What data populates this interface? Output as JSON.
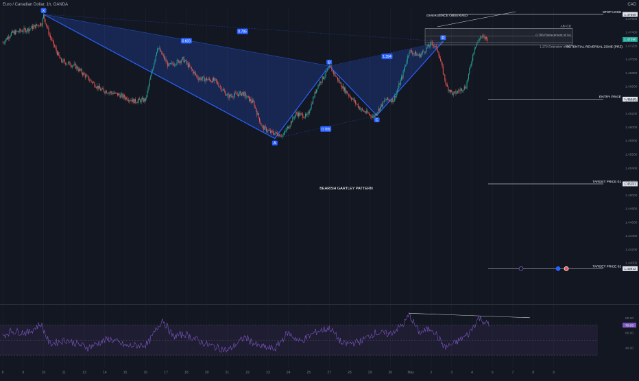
{
  "header": {
    "symbol_title": "Euro / Canadian Dollar, 1h, OANDA",
    "currency": "CAD"
  },
  "colors": {
    "background": "#131722",
    "up_candle": "#26a69a",
    "down_candle": "#ef5350",
    "pattern_line": "#2962ff",
    "pattern_fill": "#2962ff",
    "rsi_line": "#7e57c2",
    "rsi_band": "#7e57c2",
    "text": "#d1d4dc",
    "axis_text": "#787b86",
    "price_tag_bg": "#e0e3eb"
  },
  "chart_data": {
    "type": "candlestick",
    "title": "Euro / Canadian Dollar, 1h, OANDA",
    "y_price_range": [
      1.4342,
      1.4777
    ],
    "y_ticks": [
      "1.47600",
      "1.47400",
      "1.47200",
      "1.47000",
      "1.46800",
      "1.46600",
      "1.46400",
      "1.46200",
      "1.46000",
      "1.45800",
      "1.45600",
      "1.45400",
      "1.45200",
      "1.45000",
      "1.44800",
      "1.44600",
      "1.44400",
      "1.44200",
      "1.44000"
    ],
    "y_tick_values": [
      1.476,
      1.474,
      1.472,
      1.47,
      1.468,
      1.466,
      1.464,
      1.462,
      1.46,
      1.458,
      1.456,
      1.454,
      1.452,
      1.45,
      1.448,
      1.446,
      1.444,
      1.442,
      1.44
    ],
    "x_ticks": [
      "8",
      "9",
      "10",
      "11",
      "13",
      "14",
      "15",
      "16",
      "17",
      "18",
      "20",
      "21",
      "22",
      "23",
      "24",
      "25",
      "27",
      "28",
      "29",
      "30",
      "May",
      "2",
      "3",
      "4",
      "6",
      "7",
      "8",
      "9"
    ],
    "x_tick_bar": [
      0,
      24,
      48,
      72,
      96,
      120,
      144,
      168,
      192,
      216,
      240,
      264,
      288,
      312,
      336,
      360,
      384,
      408,
      432,
      456,
      480,
      504,
      528,
      552,
      576,
      600,
      624,
      648
    ],
    "series_pivots": [
      [
        0,
        1.4724
      ],
      [
        10,
        1.4738
      ],
      [
        30,
        1.4744
      ],
      [
        46,
        1.4753
      ],
      [
        48,
        1.4764
      ],
      [
        55,
        1.4735
      ],
      [
        68,
        1.4698
      ],
      [
        85,
        1.469
      ],
      [
        100,
        1.4672
      ],
      [
        115,
        1.4655
      ],
      [
        135,
        1.4648
      ],
      [
        155,
        1.4638
      ],
      [
        168,
        1.464
      ],
      [
        182,
        1.4718
      ],
      [
        195,
        1.469
      ],
      [
        212,
        1.47
      ],
      [
        230,
        1.4672
      ],
      [
        250,
        1.4668
      ],
      [
        265,
        1.4645
      ],
      [
        282,
        1.465
      ],
      [
        295,
        1.4635
      ],
      [
        305,
        1.46
      ],
      [
        315,
        1.4592
      ],
      [
        330,
        1.4588
      ],
      [
        345,
        1.462
      ],
      [
        358,
        1.4615
      ],
      [
        370,
        1.466
      ],
      [
        385,
        1.4688
      ],
      [
        400,
        1.4658
      ],
      [
        412,
        1.464
      ],
      [
        422,
        1.4625
      ],
      [
        436,
        1.4615
      ],
      [
        450,
        1.464
      ],
      [
        460,
        1.464
      ],
      [
        470,
        1.4675
      ],
      [
        478,
        1.4712
      ],
      [
        490,
        1.4705
      ],
      [
        505,
        1.4724
      ],
      [
        512,
        1.4712
      ],
      [
        522,
        1.466
      ],
      [
        530,
        1.4648
      ],
      [
        545,
        1.466
      ],
      [
        555,
        1.4718
      ],
      [
        562,
        1.4733
      ],
      [
        570,
        1.473
      ]
    ],
    "pattern": {
      "name": "BEARISH GARTLEY PATTERN",
      "points": [
        {
          "label": "X",
          "bar": 48,
          "price": 1.4766
        },
        {
          "label": "A",
          "bar": 320,
          "price": 1.4583
        },
        {
          "label": "B",
          "bar": 384,
          "price": 1.469
        },
        {
          "label": "C",
          "bar": 440,
          "price": 1.4617
        },
        {
          "label": "D",
          "bar": 518,
          "price": 1.4726
        }
      ],
      "ratios": [
        {
          "text": "0.603",
          "bar": 216,
          "price": 1.4727
        },
        {
          "text": "0.785",
          "bar": 282,
          "price": 1.4741
        },
        {
          "text": "1.394",
          "bar": 452,
          "price": 1.4704
        },
        {
          "text": "0.765",
          "bar": 380,
          "price": 1.4597
        }
      ]
    },
    "annotations": {
      "divergence": "DIVERGENCE OBSERVED",
      "stop_loss": "STOP LOSS",
      "ab_cd": "AB=CD",
      "retracement": "0.786 Retracement of XA",
      "extension": "1.272 Extension of BC",
      "prz": "POTENTIAL REVERSAL ZONE (PRZ)",
      "entry": "ENTRY PRICE",
      "target1": "TARGET PRICE 01",
      "target2": "TARGET PRICE 02"
    },
    "levels": {
      "stop_loss": {
        "label_price": "1.47659",
        "price": 1.47659
      },
      "entry": {
        "label_price": "1.46410",
        "price": 1.4641
      },
      "target1": {
        "label_price": "1.45161",
        "price": 1.45161
      },
      "target2": {
        "label_price": "1.43912",
        "price": 1.43912
      },
      "last": {
        "label_price": "1.47290",
        "price": 1.4729
      }
    },
    "rsi": {
      "ticks": [
        "80.00",
        "60.00",
        "40.00"
      ],
      "tick_values": [
        80,
        60,
        40
      ],
      "current": "70.03",
      "current_value": 70.03,
      "band": [
        30,
        70
      ],
      "range": [
        20,
        90
      ],
      "pivots": [
        [
          0,
          56
        ],
        [
          10,
          62
        ],
        [
          30,
          60
        ],
        [
          45,
          72
        ],
        [
          55,
          45
        ],
        [
          75,
          50
        ],
        [
          100,
          40
        ],
        [
          125,
          52
        ],
        [
          145,
          42
        ],
        [
          170,
          44
        ],
        [
          188,
          78
        ],
        [
          200,
          55
        ],
        [
          215,
          58
        ],
        [
          240,
          44
        ],
        [
          265,
          36
        ],
        [
          285,
          54
        ],
        [
          300,
          42
        ],
        [
          320,
          38
        ],
        [
          335,
          60
        ],
        [
          350,
          48
        ],
        [
          370,
          62
        ],
        [
          385,
          66
        ],
        [
          400,
          44
        ],
        [
          420,
          48
        ],
        [
          438,
          60
        ],
        [
          455,
          58
        ],
        [
          472,
          72
        ],
        [
          478,
          84
        ],
        [
          490,
          60
        ],
        [
          505,
          66
        ],
        [
          520,
          40
        ],
        [
          532,
          46
        ],
        [
          548,
          58
        ],
        [
          560,
          80
        ],
        [
          572,
          70
        ]
      ]
    }
  }
}
